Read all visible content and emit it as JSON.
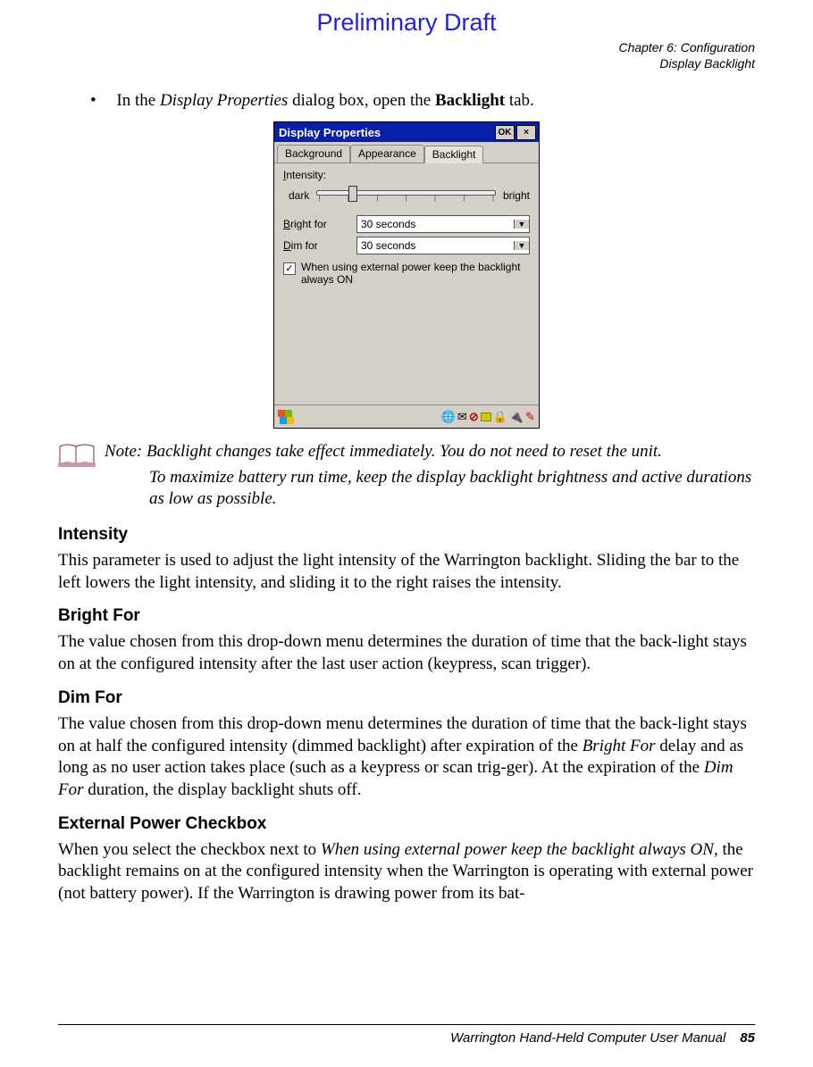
{
  "prelim": "Preliminary Draft",
  "chapter": {
    "line1": "Chapter 6:  Configuration",
    "line2": "Display Backlight"
  },
  "bullet": {
    "prefix": "In the ",
    "italic": "Display Properties",
    "mid": " dialog box, open the ",
    "bold": "Backlight",
    "suffix": " tab."
  },
  "win": {
    "title": "Display Properties",
    "ok": "OK",
    "close": "×",
    "tabs": {
      "background": "Background",
      "appearance": "Appearance",
      "backlight": "Backlight"
    },
    "intensity_lbl": "Intensity:",
    "dark": "dark",
    "bright": "bright",
    "bright_for_lbl": "Bright for",
    "dim_for_lbl": "Dim for",
    "bright_for_val": "30 seconds",
    "dim_for_val": "30 seconds",
    "chk_text": "When using external power keep the backlight always ON"
  },
  "note": {
    "label": "Note:",
    "line1": " Backlight changes take effect immediately. You do not need to reset the unit.",
    "line2": "To maximize battery run time, keep the display backlight brightness and active durations as low as possible."
  },
  "secs": {
    "intensity_h": "Intensity",
    "intensity_p": "This parameter is used to adjust the light intensity of the Warrington backlight. Sliding the bar to the left lowers the light intensity, and sliding it to the right raises the intensity.",
    "bright_h": "Bright For",
    "bright_p": "The value chosen from this drop-down menu determines the duration of time that the back-light stays on at the configured intensity after the last user action (keypress, scan trigger).",
    "dim_h": "Dim For",
    "dim_p1": "The value chosen from this drop-down menu determines the duration of time that the back-light stays on at half the configured intensity (dimmed backlight) after expiration of the ",
    "dim_i1": "Bright For",
    "dim_p2": " delay and as long as no user action takes place (such as a keypress or scan trig-ger). At the expiration of the ",
    "dim_i2": "Dim For",
    "dim_p3": " duration, the display backlight shuts off.",
    "ext_h": "External Power Checkbox",
    "ext_p1": "When you select the checkbox next to ",
    "ext_i1": "When using external power keep the backlight always ON",
    "ext_p2": ", the backlight remains on at the configured intensity when the Warrington is operating with external power (not battery power). If the Warrington is drawing power from its bat-"
  },
  "footer": {
    "manual": "Warrington Hand-Held Computer User Manual",
    "page": "85"
  }
}
